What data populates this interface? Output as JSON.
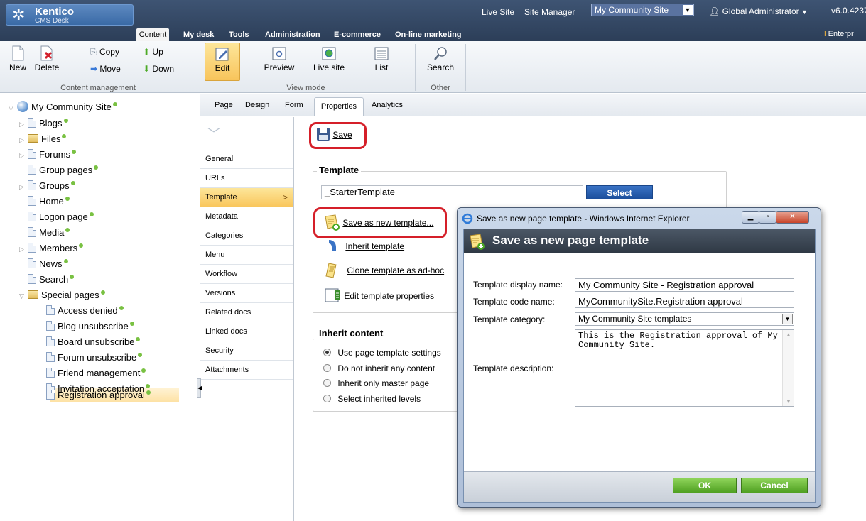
{
  "app": {
    "logo_name": "Kentico",
    "logo_sub": "CMS Desk",
    "live_site": "Live Site",
    "site_manager": "Site Manager",
    "site_selected": "My Community Site",
    "user": "Global Administrator",
    "version": "v6.0.4237",
    "edition": "Enterpr"
  },
  "main_tabs": [
    "Content",
    "My desk",
    "Tools",
    "Administration",
    "E-commerce",
    "On-line marketing"
  ],
  "ribbon": {
    "copy": "Copy",
    "up": "Up",
    "new": "New",
    "delete": "Delete",
    "move": "Move",
    "down": "Down",
    "group_content": "Content management",
    "edit": "Edit",
    "preview": "Preview",
    "live_site": "Live site",
    "list": "List",
    "group_view": "View mode",
    "search": "Search",
    "group_other": "Other"
  },
  "tree": {
    "root": "My Community Site",
    "items": [
      "Blogs",
      "Files",
      "Forums",
      "Group pages",
      "Groups",
      "Home",
      "Logon page",
      "Media",
      "Members",
      "News",
      "Search",
      "Special pages"
    ],
    "special": [
      "Access denied",
      "Blog unsubscribe",
      "Board unsubscribe",
      "Forum unsubscribe",
      "Friend management",
      "Invitation acceptation",
      "Registration approval"
    ]
  },
  "page_tabs": [
    "Page",
    "Design",
    "Form",
    "Properties",
    "Analytics"
  ],
  "left_menu": [
    "General",
    "URLs",
    "Template",
    "Metadata",
    "Categories",
    "Menu",
    "Workflow",
    "Versions",
    "Related docs",
    "Linked docs",
    "Security",
    "Attachments"
  ],
  "content": {
    "save": "Save",
    "template_title": "Template",
    "template_value": "_StarterTemplate",
    "select": "Select",
    "save_as_new": "Save as new template...",
    "inherit_template": "Inherit template",
    "clone_template": "Clone template as ad-hoc",
    "edit_properties": "Edit template properties",
    "inherit_title": "Inherit content",
    "radios": [
      "Use page template settings",
      "Do not inherit any content",
      "Inherit only master page",
      "Select inherited levels"
    ]
  },
  "dialog": {
    "window_title": "Save as new page template - Windows Internet Explorer",
    "header": "Save as new page template",
    "display_name_label": "Template display name:",
    "display_name": "My Community Site - Registration approval",
    "code_name_label": "Template code name:",
    "code_name": "MyCommunitySite.Registration approval",
    "category_label": "Template category:",
    "category": "My Community Site templates",
    "description_label": "Template description:",
    "description": "This is the Registration approval of My Community Site.",
    "ok": "OK",
    "cancel": "Cancel"
  }
}
